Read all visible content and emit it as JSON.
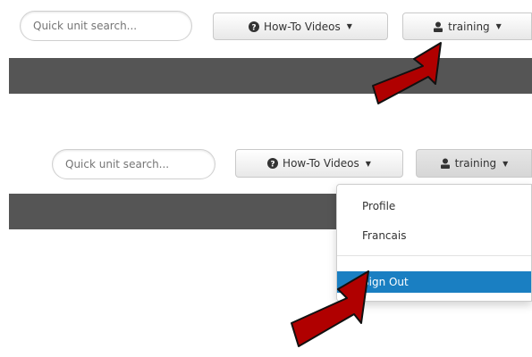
{
  "top": {
    "search": {
      "placeholder": "Quick unit search..."
    },
    "howto_label": "How-To Videos",
    "user_label": "training"
  },
  "bottom": {
    "search": {
      "placeholder": "Quick unit search..."
    },
    "howto_label": "How-To Videos",
    "user_label": "training",
    "menu": {
      "items": [
        "Profile",
        "Francais"
      ],
      "signout_label": "Sign Out"
    }
  },
  "colors": {
    "navbar": "#555555",
    "active_item": "#1a7fc2",
    "arrow_fill": "#b00000"
  },
  "icons": [
    "question-circle-icon",
    "user-icon",
    "caret-down-icon",
    "pointer-arrow-icon"
  ]
}
